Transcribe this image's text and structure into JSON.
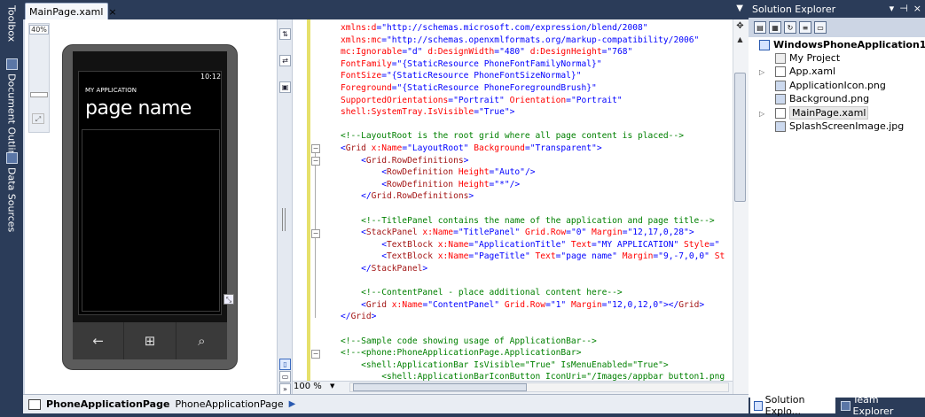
{
  "doc_tab": {
    "label": "MainPage.xaml",
    "close": "×"
  },
  "left_strip": {
    "toolbox": "Toolbox",
    "outline": "Document Outline",
    "datasources": "Data Sources"
  },
  "design": {
    "zoom_label": "40%",
    "phone": {
      "clock": "10:12",
      "app_title": "MY APPLICATION",
      "page_title": "page name",
      "keys": [
        "←",
        "⊞",
        "⌕"
      ]
    }
  },
  "code_lines": [
    [
      {
        "c": "attr",
        "t": "xmlns:d"
      },
      {
        "c": "brk",
        "t": "="
      },
      {
        "c": "val",
        "t": "\"http://schemas.microsoft.com/expression/blend/2008\""
      }
    ],
    [
      {
        "c": "attr",
        "t": "xmlns:mc"
      },
      {
        "c": "brk",
        "t": "="
      },
      {
        "c": "val",
        "t": "\"http://schemas.openxmlformats.org/markup-compatibility/2006\""
      }
    ],
    [
      {
        "c": "attr",
        "t": "mc:Ignorable"
      },
      {
        "c": "brk",
        "t": "="
      },
      {
        "c": "val",
        "t": "\"d\""
      },
      {
        "c": "attr",
        "t": " d:DesignWidth"
      },
      {
        "c": "brk",
        "t": "="
      },
      {
        "c": "val",
        "t": "\"480\""
      },
      {
        "c": "attr",
        "t": " d:DesignHeight"
      },
      {
        "c": "brk",
        "t": "="
      },
      {
        "c": "val",
        "t": "\"768\""
      }
    ],
    [
      {
        "c": "attr",
        "t": "FontFamily"
      },
      {
        "c": "brk",
        "t": "="
      },
      {
        "c": "val",
        "t": "\"{StaticResource PhoneFontFamilyNormal}\""
      }
    ],
    [
      {
        "c": "attr",
        "t": "FontSize"
      },
      {
        "c": "brk",
        "t": "="
      },
      {
        "c": "val",
        "t": "\"{StaticResource PhoneFontSizeNormal}\""
      }
    ],
    [
      {
        "c": "attr",
        "t": "Foreground"
      },
      {
        "c": "brk",
        "t": "="
      },
      {
        "c": "val",
        "t": "\"{StaticResource PhoneForegroundBrush}\""
      }
    ],
    [
      {
        "c": "attr",
        "t": "SupportedOrientations"
      },
      {
        "c": "brk",
        "t": "="
      },
      {
        "c": "val",
        "t": "\"Portrait\""
      },
      {
        "c": "attr",
        "t": " Orientation"
      },
      {
        "c": "brk",
        "t": "="
      },
      {
        "c": "val",
        "t": "\"Portrait\""
      }
    ],
    [
      {
        "c": "attr",
        "t": "shell:SystemTray.IsVisible"
      },
      {
        "c": "brk",
        "t": "="
      },
      {
        "c": "val",
        "t": "\"True\""
      },
      {
        "c": "brk",
        "t": ">"
      }
    ],
    [],
    [
      {
        "c": "cmt",
        "t": "<!--LayoutRoot is the root grid where all page content is placed-->"
      }
    ],
    [
      {
        "c": "brk",
        "t": "<"
      },
      {
        "c": "tag",
        "t": "Grid"
      },
      {
        "c": "attr",
        "t": " x:Name"
      },
      {
        "c": "brk",
        "t": "="
      },
      {
        "c": "val",
        "t": "\"LayoutRoot\""
      },
      {
        "c": "attr",
        "t": " Background"
      },
      {
        "c": "brk",
        "t": "="
      },
      {
        "c": "val",
        "t": "\"Transparent\""
      },
      {
        "c": "brk",
        "t": ">"
      }
    ],
    [
      {
        "c": "brk",
        "t": "    <"
      },
      {
        "c": "tag",
        "t": "Grid.RowDefinitions"
      },
      {
        "c": "brk",
        "t": ">"
      }
    ],
    [
      {
        "c": "brk",
        "t": "        <"
      },
      {
        "c": "tag",
        "t": "RowDefinition"
      },
      {
        "c": "attr",
        "t": " Height"
      },
      {
        "c": "brk",
        "t": "="
      },
      {
        "c": "val",
        "t": "\"Auto\""
      },
      {
        "c": "brk",
        "t": "/>"
      }
    ],
    [
      {
        "c": "brk",
        "t": "        <"
      },
      {
        "c": "tag",
        "t": "RowDefinition"
      },
      {
        "c": "attr",
        "t": " Height"
      },
      {
        "c": "brk",
        "t": "="
      },
      {
        "c": "val",
        "t": "\"*\""
      },
      {
        "c": "brk",
        "t": "/>"
      }
    ],
    [
      {
        "c": "brk",
        "t": "    </"
      },
      {
        "c": "tag",
        "t": "Grid.RowDefinitions"
      },
      {
        "c": "brk",
        "t": ">"
      }
    ],
    [],
    [
      {
        "c": "cmt",
        "t": "    <!--TitlePanel contains the name of the application and page title-->"
      }
    ],
    [
      {
        "c": "brk",
        "t": "    <"
      },
      {
        "c": "tag",
        "t": "StackPanel"
      },
      {
        "c": "attr",
        "t": " x:Name"
      },
      {
        "c": "brk",
        "t": "="
      },
      {
        "c": "val",
        "t": "\"TitlePanel\""
      },
      {
        "c": "attr",
        "t": " Grid.Row"
      },
      {
        "c": "brk",
        "t": "="
      },
      {
        "c": "val",
        "t": "\"0\""
      },
      {
        "c": "attr",
        "t": " Margin"
      },
      {
        "c": "brk",
        "t": "="
      },
      {
        "c": "val",
        "t": "\"12,17,0,28\""
      },
      {
        "c": "brk",
        "t": ">"
      }
    ],
    [
      {
        "c": "brk",
        "t": "        <"
      },
      {
        "c": "tag",
        "t": "TextBlock"
      },
      {
        "c": "attr",
        "t": " x:Name"
      },
      {
        "c": "brk",
        "t": "="
      },
      {
        "c": "val",
        "t": "\"ApplicationTitle\""
      },
      {
        "c": "attr",
        "t": " Text"
      },
      {
        "c": "brk",
        "t": "="
      },
      {
        "c": "val",
        "t": "\"MY APPLICATION\""
      },
      {
        "c": "attr",
        "t": " Style"
      },
      {
        "c": "brk",
        "t": "=\""
      }
    ],
    [
      {
        "c": "brk",
        "t": "        <"
      },
      {
        "c": "tag",
        "t": "TextBlock"
      },
      {
        "c": "attr",
        "t": " x:Name"
      },
      {
        "c": "brk",
        "t": "="
      },
      {
        "c": "val",
        "t": "\"PageTitle\""
      },
      {
        "c": "attr",
        "t": " Text"
      },
      {
        "c": "brk",
        "t": "="
      },
      {
        "c": "val",
        "t": "\"page name\""
      },
      {
        "c": "attr",
        "t": " Margin"
      },
      {
        "c": "brk",
        "t": "="
      },
      {
        "c": "val",
        "t": "\"9,-7,0,0\""
      },
      {
        "c": "attr",
        "t": " St"
      }
    ],
    [
      {
        "c": "brk",
        "t": "    </"
      },
      {
        "c": "tag",
        "t": "StackPanel"
      },
      {
        "c": "brk",
        "t": ">"
      }
    ],
    [],
    [
      {
        "c": "cmt",
        "t": "    <!--ContentPanel - place additional content here-->"
      }
    ],
    [
      {
        "c": "brk",
        "t": "    <"
      },
      {
        "c": "tag",
        "t": "Grid"
      },
      {
        "c": "attr",
        "t": " x:Name"
      },
      {
        "c": "brk",
        "t": "="
      },
      {
        "c": "val",
        "t": "\"ContentPanel\""
      },
      {
        "c": "attr",
        "t": " Grid.Row"
      },
      {
        "c": "brk",
        "t": "="
      },
      {
        "c": "val",
        "t": "\"1\""
      },
      {
        "c": "attr",
        "t": " Margin"
      },
      {
        "c": "brk",
        "t": "="
      },
      {
        "c": "val",
        "t": "\"12,0,12,0\""
      },
      {
        "c": "brk",
        "t": "></"
      },
      {
        "c": "tag",
        "t": "Grid"
      },
      {
        "c": "brk",
        "t": ">"
      }
    ],
    [
      {
        "c": "brk",
        "t": "</"
      },
      {
        "c": "tag",
        "t": "Grid"
      },
      {
        "c": "brk",
        "t": ">"
      }
    ],
    [],
    [
      {
        "c": "cmt",
        "t": "<!--Sample code showing usage of ApplicationBar-->"
      }
    ],
    [
      {
        "c": "cmt",
        "t": "<!--<phone:PhoneApplicationPage.ApplicationBar>"
      }
    ],
    [
      {
        "c": "cmt",
        "t": "    <shell:ApplicationBar IsVisible=\"True\" IsMenuEnabled=\"True\">"
      }
    ],
    [
      {
        "c": "cmt",
        "t": "        <shell:ApplicationBarIconButton IconUri=\"/Images/appbar_button1.png"
      }
    ]
  ],
  "editor": {
    "zoom": "100 %"
  },
  "breadcrumb": {
    "bold": "PhoneApplicationPage",
    "text": "PhoneApplicationPage"
  },
  "solution_explorer": {
    "title": "Solution Explorer",
    "controls": [
      "▾",
      "⊣",
      "×"
    ],
    "solution": "WindowsPhoneApplication1",
    "items": [
      "My Project",
      "App.xaml",
      "ApplicationIcon.png",
      "Background.png",
      "MainPage.xaml",
      "SplashScreenImage.jpg"
    ],
    "tabs": [
      "Solution Explo...",
      "Team Explorer"
    ]
  },
  "colors": {
    "chrome": "#2b3c59",
    "attr": "#ff0000",
    "value": "#0000ff",
    "tag": "#a31515",
    "comment": "#008000"
  }
}
